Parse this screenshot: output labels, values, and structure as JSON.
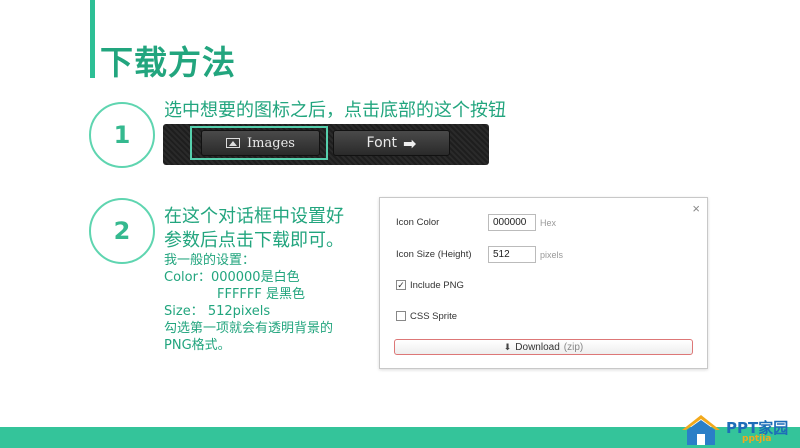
{
  "page": {
    "title": "下载方法",
    "step1": {
      "number": "1",
      "text": "选中想要的图标之后，点击底部的这个按钮",
      "images_button": "Images",
      "font_button": "Font"
    },
    "step2": {
      "number": "2",
      "heading_line1": "在这个对话框中设置好",
      "heading_line2": "参数后点击下载即可。",
      "line1": "我一般的设置：",
      "line2": "Color：000000是白色",
      "line3": "FFFFFF 是黑色",
      "line4": "Size：  512pixels",
      "line5": "勾选第一项就会有透明背景的",
      "line6": "PNG格式。"
    }
  },
  "dialog": {
    "close": "×",
    "icon_color_label": "Icon Color",
    "icon_color_value": "000000",
    "icon_color_unit": "Hex",
    "icon_size_label": "Icon Size (Height)",
    "icon_size_value": "512",
    "icon_size_unit": "pixels",
    "include_png_label": "Include PNG",
    "include_png_checked": true,
    "css_sprite_label": "CSS Sprite",
    "css_sprite_checked": false,
    "download_label": "Download",
    "download_suffix": "(zip)"
  },
  "logo": {
    "text": "PPT家园",
    "sub": "pptjia"
  },
  "colors": {
    "accent": "#2dbf95",
    "title": "#22a57e",
    "footer": "#34c49a"
  }
}
